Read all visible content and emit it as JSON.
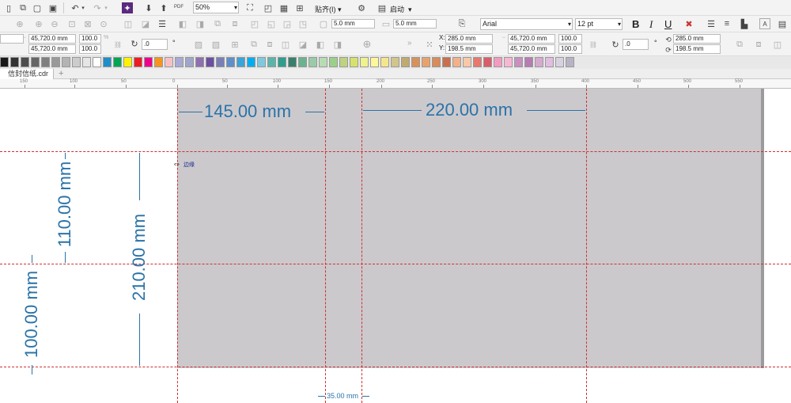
{
  "toolbar1": {
    "zoom": "50%",
    "snap_label": "贴齐(I)",
    "launch_label": "启动",
    "pdf_label": "PDF"
  },
  "toolbar2": {
    "outline_width_1": "5.0 mm",
    "outline_width_2": "5.0 mm",
    "font_name": "Arial",
    "font_size": "12 pt",
    "bold": "B",
    "italic": "I",
    "underline": "U"
  },
  "toolbar3": {
    "left_x": "45,720.0 mm",
    "left_y": "45,720.0 mm",
    "left_scale_x": "100.0",
    "left_scale_y": "100.0",
    "left_pct": "%",
    "left_rotation": ".0",
    "x_label": "X:",
    "y_label": "Y:",
    "x_value": "285.0 mm",
    "y_value": "198.5 mm",
    "size_w": "45,720.0 mm",
    "size_h": "45,720.0 mm",
    "scale_x": "100.0",
    "scale_y": "100.0",
    "rotation": ".0",
    "right_x": "285.0 mm",
    "right_y": "198.5 mm"
  },
  "palette_colors": [
    "#1a1a1a",
    "#333333",
    "#4d4d4d",
    "#666666",
    "#808080",
    "#999999",
    "#b3b3b3",
    "#cccccc",
    "#e6e6e6",
    "#ffffff",
    "#1f8ec9",
    "#00a651",
    "#fff200",
    "#ed1c24",
    "#ec008c",
    "#f7941d",
    "#f7c0c6",
    "#a9a9d6",
    "#9fa6c9",
    "#8e6fb0",
    "#6b4fa0",
    "#7a7fb7",
    "#5f8fc9",
    "#3aa3d8",
    "#00aeef",
    "#7fc9df",
    "#5ab5a8",
    "#2e9e8e",
    "#3a7f6b",
    "#6bb38e",
    "#98cba8",
    "#b7dcb5",
    "#9ccf8a",
    "#bed37f",
    "#d6e26b",
    "#eff28f",
    "#fff799",
    "#f5e68c",
    "#d2c58b",
    "#c1a96f",
    "#d9915a",
    "#e8a36d",
    "#d88b5b",
    "#c96f4f",
    "#f2b188",
    "#f7c9a8",
    "#e6796b",
    "#d95d6a",
    "#f49ac1",
    "#f6b7d2",
    "#c890c0",
    "#b57db3",
    "#d6a9d0",
    "#e1bde0",
    "#d7d2df",
    "#b8b3c4"
  ],
  "tab": {
    "doc_name": "信封信纸.cdr",
    "add_label": "+"
  },
  "ruler": {
    "labels": [
      "150",
      "100",
      "50",
      "0",
      "50",
      "100",
      "150",
      "200",
      "250",
      "300",
      "350",
      "400",
      "450",
      "500",
      "550"
    ]
  },
  "cursor_label": "边缘",
  "dimensions": {
    "w145": "145.00 mm",
    "w220": "220.00 mm",
    "h110": "110.00 mm",
    "h210": "210.00 mm",
    "h100": "100.00 mm",
    "w35": "35.00 mm"
  }
}
